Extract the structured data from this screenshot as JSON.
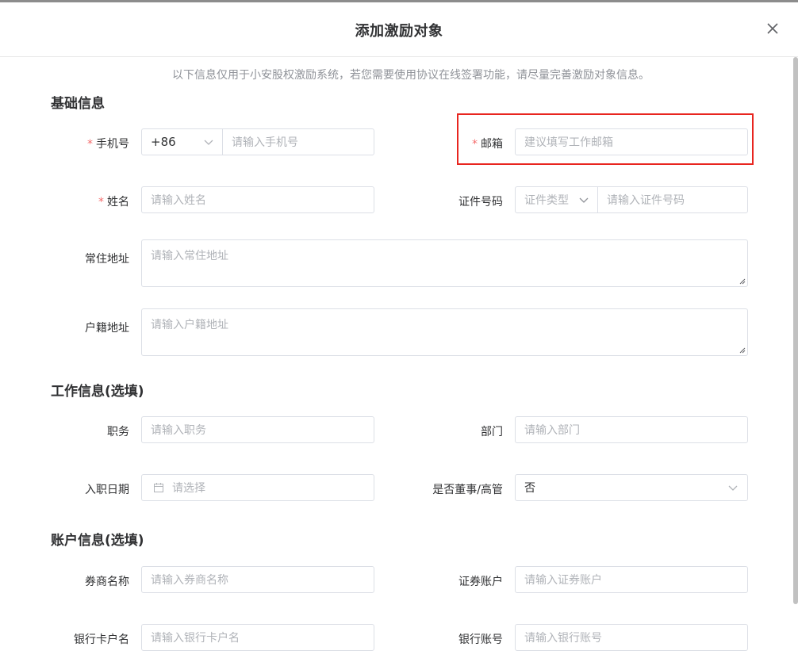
{
  "dialog": {
    "title": "添加激励对象"
  },
  "notice": "以下信息仅用于小安股权激励系统，若您需要使用协议在线签署功能，请尽量完善激励对象信息。",
  "sections": {
    "basic": "基础信息",
    "work": "工作信息(选填)",
    "account": "账户信息(选填)"
  },
  "fields": {
    "phone": {
      "label": "手机号",
      "required": "*",
      "prefix": "+86",
      "placeholder": "请输入手机号"
    },
    "email": {
      "label": "邮箱",
      "required": "*",
      "placeholder": "建议填写工作邮箱"
    },
    "name": {
      "label": "姓名",
      "required": "*",
      "placeholder": "请输入姓名"
    },
    "id_number": {
      "label": "证件号码",
      "type_placeholder": "证件类型",
      "placeholder": "请输入证件号码"
    },
    "residence": {
      "label": "常住地址",
      "placeholder": "请输入常住地址"
    },
    "household": {
      "label": "户籍地址",
      "placeholder": "请输入户籍地址"
    },
    "position": {
      "label": "职务",
      "placeholder": "请输入职务"
    },
    "department": {
      "label": "部门",
      "placeholder": "请输入部门"
    },
    "entry_date": {
      "label": "入职日期",
      "placeholder": "请选择"
    },
    "is_director": {
      "label": "是否董事/高管",
      "value": "否"
    },
    "broker": {
      "label": "券商名称",
      "placeholder": "请输入券商名称"
    },
    "securities_account": {
      "label": "证券账户",
      "placeholder": "请输入证券账户"
    },
    "bank_holder": {
      "label": "银行卡户名",
      "placeholder": "请输入银行卡户名"
    },
    "bank_account": {
      "label": "银行账号",
      "placeholder": "请输入银行账号"
    }
  },
  "colors": {
    "required": "#f56c6c",
    "highlight": "#e8251f",
    "border": "#dcdfe6",
    "placeholder": "#b0b3b8"
  },
  "icons": {
    "close": "close-icon",
    "chevron": "chevron-down-icon",
    "calendar": "calendar-icon"
  }
}
